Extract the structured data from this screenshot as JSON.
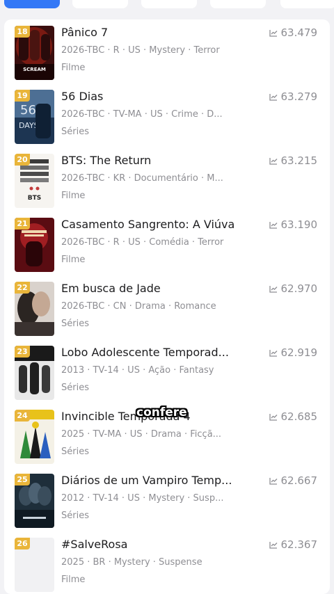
{
  "tabs": [
    {
      "active": true
    },
    {
      "active": false
    },
    {
      "active": false
    },
    {
      "active": false
    },
    {
      "active": false
    }
  ],
  "caption": "confere",
  "rows": [
    {
      "rank": "18",
      "title": "Pânico 7",
      "score": "63.479",
      "meta": "2026-TBC · R · US · Mystery · Terror",
      "kind": "Filme",
      "poster": "poster-scream",
      "poster_label": "SCREAM"
    },
    {
      "rank": "19",
      "title": "56 Dias",
      "score": "63.279",
      "meta": "2026-TBC · TV-MA · US · Crime · D...",
      "kind": "Séries",
      "poster": "poster-56-days",
      "poster_label": "DAYS"
    },
    {
      "rank": "20",
      "title": "BTS: The Return",
      "score": "63.215",
      "meta": "2026-TBC · KR · Documentário · M...",
      "kind": "Filme",
      "poster": "poster-bts",
      "poster_label": "BTS"
    },
    {
      "rank": "21",
      "title": "Casamento Sangrento: A Viúva",
      "score": "63.190",
      "meta": "2026-TBC · R · US · Comédia · Terror",
      "kind": "Filme",
      "poster": "poster-ready-or-not",
      "poster_label": ""
    },
    {
      "rank": "22",
      "title": "Em busca de Jade",
      "score": "62.970",
      "meta": "2026-TBC · CN · Drama · Romance",
      "kind": "Séries",
      "poster": "poster-jade",
      "poster_label": ""
    },
    {
      "rank": "23",
      "title": "Lobo Adolescente Temporad...",
      "score": "62.919",
      "meta": "2013 · TV-14 · US · Ação · Fantasy",
      "kind": "Séries",
      "poster": "poster-teen-wolf",
      "poster_label": ""
    },
    {
      "rank": "24",
      "title": "Invincible Temporada 4",
      "score": "62.685",
      "meta": "2025 · TV-MA · US · Drama · Ficçã...",
      "kind": "Séries",
      "poster": "poster-invincible",
      "poster_label": ""
    },
    {
      "rank": "25",
      "title": "Diários de um Vampiro Temp...",
      "score": "62.667",
      "meta": "2012 · TV-14 · US · Mystery · Susp...",
      "kind": "Séries",
      "poster": "poster-vampire-diaries",
      "poster_label": ""
    },
    {
      "rank": "26",
      "title": "#SalveRosa",
      "score": "62.367",
      "meta": "2025 · BR · Mystery · Suspense",
      "kind": "Filme",
      "poster": "poster-blank",
      "poster_label": ""
    }
  ]
}
